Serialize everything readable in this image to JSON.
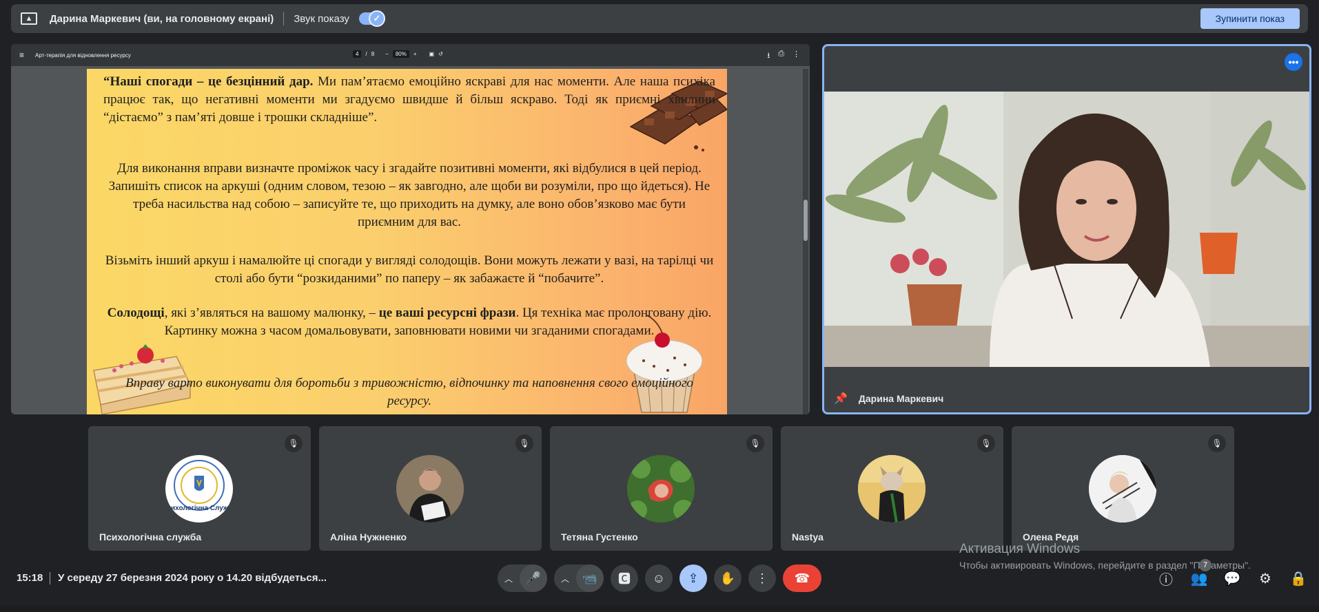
{
  "topbar": {
    "presenter": "Дарина Маркевич (ви, на головному екрані)",
    "sound_label": "Звук показу",
    "sound_on": true,
    "stop_label": "Зупинити показ"
  },
  "pdf": {
    "title": "Арт-терапія для відновлення ресурсу",
    "page_current": "4",
    "page_total": "8",
    "zoom": "80%",
    "p1_bold": "“Наші спогади – це безцінний дар.",
    "p1_rest": " Ми пам’ятаємо емоційно яскраві для нас моменти. Але наша психіка працює так, що негативні моменти ми згадуємо швидше й більш яскраво. Тоді як приємні хвилини “дістаємо” з пам’яті довше і трошки складніше”.",
    "p2": "Для виконання вправи визначте проміжок часу і згадайте позитивні моменти, які відбулися в цей період. Запишіть список на аркуші (одним словом, тезою – як завгодно, але щоби ви розуміли, про що йдеться). Не треба насильства над собою – записуйте те, що приходить на думку, але воно обов’язково має бути приємним для вас.",
    "p3": "Візьміть інший аркуш і намалюйте ці спогади у вигляді солодощів. Вони можуть лежати у вазі, на тарілці чи столі або бути “розкиданими” по паперу – як забажаєте й “побачите”.",
    "p4_bold1": "Солодощі",
    "p4_mid": ", які з’являться на вашому малюнку, – ",
    "p4_bold2": "це ваші ресурсні фрази",
    "p4_rest": ". Ця техніка має пролонговану дію. Картинку можна з часом домальовувати, заповнювати новими чи згаданими спогадами.",
    "p5": "Вправу варто виконувати для боротьби з тривожністю, відпочинку та наповнення свого емоційного ресурсу."
  },
  "presenter_tile": {
    "name": "Дарина Маркевич"
  },
  "participants": [
    {
      "name": "Психологічна служба",
      "avatar_text": "Психологічна Служба"
    },
    {
      "name": "Аліна Нужненко"
    },
    {
      "name": "Тетяна Густенко"
    },
    {
      "name": "Nastya"
    },
    {
      "name": "Олена Редя"
    }
  ],
  "watermark": {
    "title": "Активация Windows",
    "subtitle": "Чтобы активировать Windows, перейдите в раздел \"Параметры\"."
  },
  "bottombar": {
    "time": "15:18",
    "meeting_title": "У середу 27 березня 2024 року о 14.20 відбудеться...",
    "people_count": "7"
  },
  "colors": {
    "accent": "#8ab4f8",
    "hangup": "#ea4335",
    "background": "#202124",
    "tile": "#3c4043"
  }
}
